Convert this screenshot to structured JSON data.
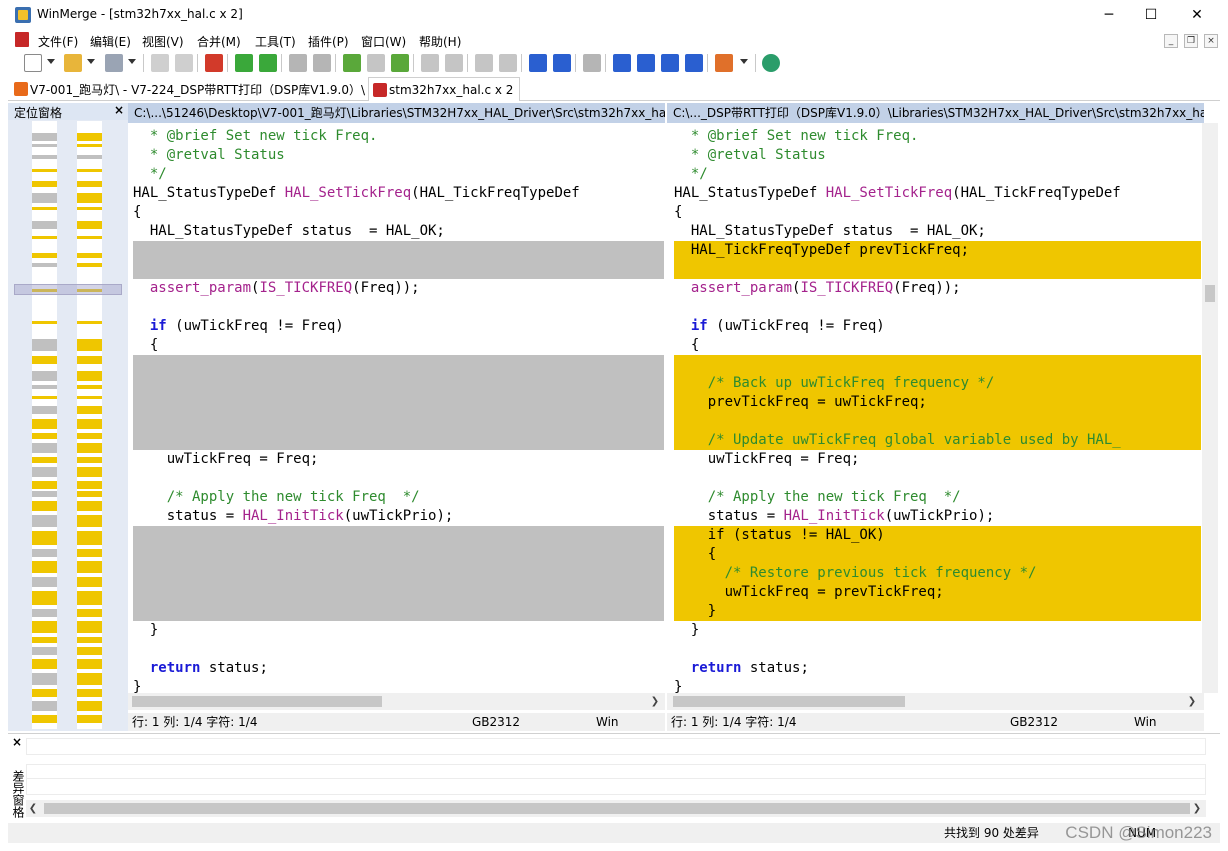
{
  "window": {
    "title": "WinMerge - [stm32h7xx_hal.c x 2]",
    "min_glyph": "─",
    "max_glyph": "☐",
    "close_glyph": "✕"
  },
  "menu": [
    "文件(F)",
    "编辑(E)",
    "视图(V)",
    "合并(M)",
    "工具(T)",
    "插件(P)",
    "窗口(W)",
    "帮助(H)"
  ],
  "mdi": {
    "min": "_",
    "restore": "❐",
    "close": "×"
  },
  "toolbar_icons": [
    "new-icon",
    "open-icon",
    "save-icon",
    "undo-icon",
    "redo-icon",
    "merge-mode-icon",
    "next-diff-icon",
    "prev-diff-icon",
    "first-conflict-icon",
    "last-conflict-icon",
    "current-diff-icon",
    "select-all-diffs-icon",
    "copy-right-icon",
    "copy-left-icon",
    "copy-right-advance-icon",
    "copy-left-advance-icon",
    "all-right-icon",
    "all-left-icon",
    "compare-icon",
    "left-first-icon",
    "left-prev-icon",
    "right-next-icon",
    "right-last-icon",
    "options-icon",
    "refresh-icon"
  ],
  "tabs": [
    {
      "label": "V7-001_跑马灯\\ - V7-224_DSP带RTT打印（DSP库V1.9.0）\\",
      "active": false
    },
    {
      "label": "stm32h7xx_hal.c x 2",
      "active": true
    }
  ],
  "location_pane": {
    "title": "定位窗格",
    "close": "×"
  },
  "left_pane": {
    "path": "C:\\...\\51246\\Desktop\\V7-001_跑马灯\\Libraries\\STM32H7xx_HAL_Driver\\Src\\stm32h7xx_hal.c",
    "status": {
      "pos": "行: 1  列: 1/4  字符: 1/4",
      "encoding": "GB2312",
      "eol": "Win"
    }
  },
  "right_pane": {
    "path": "C:\\..._DSP带RTT打印（DSP库V1.9.0）\\Libraries\\STM32H7xx_HAL_Driver\\Src\\stm32h7xx_hal.c",
    "status": {
      "pos": "行: 1  列: 1/4  字符: 1/4",
      "encoding": "GB2312",
      "eol": "Win"
    }
  },
  "code": {
    "l_brief": "  * @brief Set new tick Freq.",
    "l_retval": "  * @retval Status",
    "l_endc": "  */",
    "l_sig_type": "HAL_StatusTypeDef ",
    "l_sig_fn": "HAL_SetTickFreq",
    "l_sig_args": "(HAL_TickFreqTypeDef",
    "l_open": "{",
    "l_status": "  HAL_StatusTypeDef status  = HAL_OK;",
    "l_prev": "  HAL_TickFreqTypeDef prevTickFreq;",
    "l_assert_fn": "assert_param",
    "l_assert_p1": "(",
    "l_assert_mac": "IS_TICKFREQ",
    "l_assert_p2": "(Freq));",
    "l_if_kw": "if",
    "l_if_rest": " (uwTickFreq != Freq)",
    "l_brace_in": "  {",
    "l_backup_com": "    /* Back up uwTickFreq frequency */",
    "l_prev_assign": "    prevTickFreq = uwTickFreq;",
    "l_update_com": "    /* Update uwTickFreq global variable used by HAL_",
    "l_freq_assign": "    uwTickFreq = Freq;",
    "l_apply_com": "    /* Apply the new tick Freq  */",
    "l_status_eq": "    status = ",
    "l_inittick": "HAL_InitTick",
    "l_inittick_args": "(uwTickPrio);",
    "l_if2": "    if (status != HAL_OK)",
    "l_brace2": "    {",
    "l_restore_com": "      /* Restore previous tick frequency */",
    "l_restore_assign": "      uwTickFreq = prevTickFreq;",
    "l_brace2_close": "    }",
    "l_brace_close_in": "  }",
    "l_return_kw": "return",
    "l_return_rest": " status;",
    "l_close": "}"
  },
  "diff_pane": {
    "label": "差异窗格",
    "close": "×"
  },
  "bottom_status": "共找到 90 处差异",
  "numlock": "NUM",
  "watermark": "CSDN @Simon223",
  "colors": {
    "diff_yellow": "#efc600",
    "diff_gray": "#c0c0c0",
    "header_blue": "#c2d1e7",
    "comment_green": "#2e8b2e",
    "keyword_blue": "#1a1ad6",
    "macro_purple": "#a4228c"
  }
}
